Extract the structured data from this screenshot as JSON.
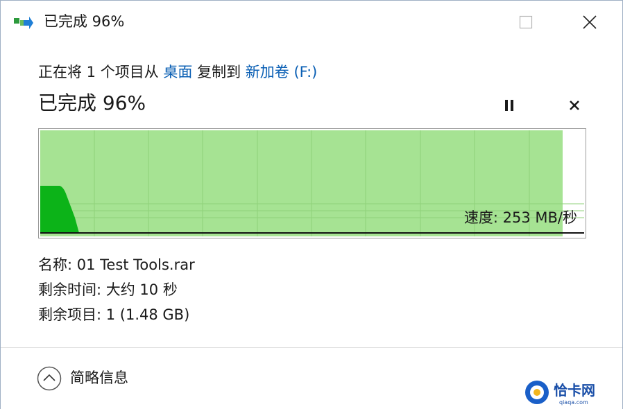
{
  "window": {
    "title": "已完成 96%"
  },
  "copy": {
    "prefix": "正在将 1 个项目从",
    "source": "桌面",
    "middle": "复制到",
    "destination": "新加卷 (F:)"
  },
  "progress": {
    "title": "已完成 96%",
    "percent": 96
  },
  "speed": {
    "label": "速度: 253 MB/秒",
    "value_mb_per_s": 253
  },
  "details": {
    "name": "名称: 01 Test Tools.rar",
    "time_remaining": "剩余时间: 大约 10 秒",
    "items_remaining": "剩余项目: 1 (1.48 GB)"
  },
  "footer": {
    "collapse_label": "简略信息"
  },
  "watermark": {
    "text": "恰卡网",
    "sub": "qiaqa.com"
  },
  "colors": {
    "graph_fill": "#a6e393",
    "graph_peak": "#0cb318",
    "link": "#0a5fb4"
  },
  "icons": {
    "app": "copy-arrow-icon",
    "pause": "pause-icon",
    "cancel": "close-icon",
    "collapse": "chevron-up-icon"
  }
}
